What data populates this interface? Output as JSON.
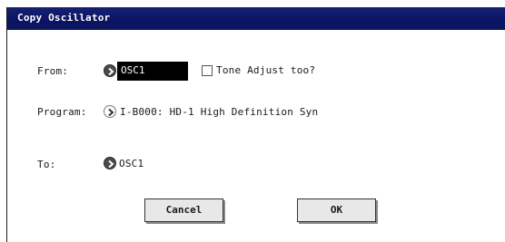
{
  "dialog": {
    "title": "Copy Oscillator",
    "from_label": "From:",
    "from_value": "OSC1",
    "tone_adjust_label": "Tone Adjust too?",
    "tone_adjust_checked": false,
    "program_label": "Program:",
    "program_value": "I-B000: HD-1 High Definition Syn",
    "to_label": "To:",
    "to_value": "OSC1",
    "cancel_label": "Cancel",
    "ok_label": "OK"
  },
  "colors": {
    "titlebar": "#0a1463",
    "title_text": "#ffffff",
    "selected_value_bg": "#000000"
  },
  "icons": {
    "from_selector": "chevron-right-icon",
    "program_selector": "chevron-right-icon",
    "to_selector": "chevron-right-icon"
  }
}
